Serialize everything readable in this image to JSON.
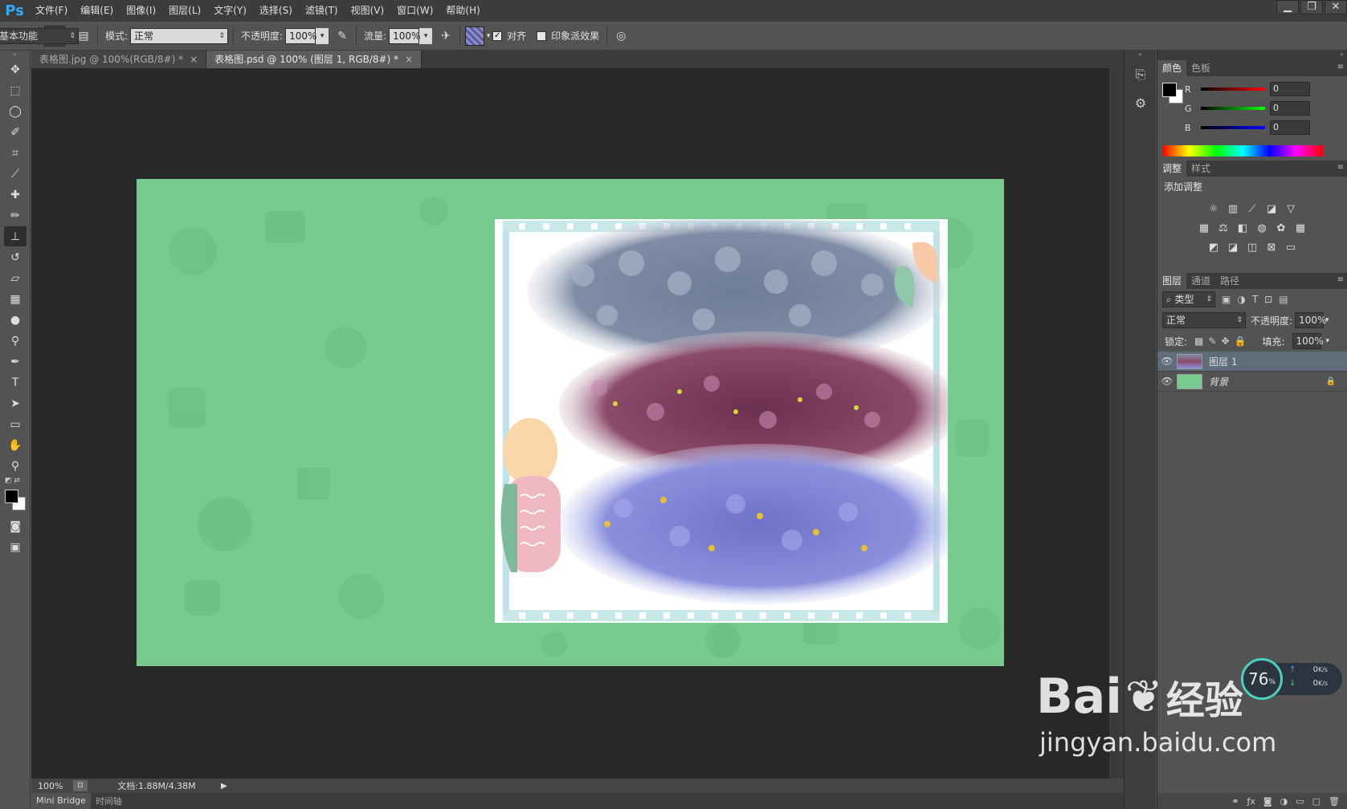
{
  "app": {
    "logo": "Ps"
  },
  "menu": {
    "items": [
      "文件(F)",
      "编辑(E)",
      "图像(I)",
      "图层(L)",
      "文字(Y)",
      "选择(S)",
      "滤镜(T)",
      "视图(V)",
      "窗口(W)",
      "帮助(H)"
    ]
  },
  "window_controls": {
    "minimize": "▁",
    "restore": "❐",
    "close": "✕"
  },
  "options": {
    "brush_size": "80",
    "mode_label": "模式:",
    "mode_value": "正常",
    "opacity_label": "不透明度:",
    "opacity_value": "100%",
    "flow_label": "流量:",
    "flow_value": "100%",
    "align_label": "对齐",
    "impression_label": "印象派效果",
    "workspace": "基本功能"
  },
  "tabs": [
    {
      "label": "表格图.jpg @ 100%(RGB/8#) *"
    },
    {
      "label": "表格图.psd @ 100% (图层 1, RGB/8#) *"
    }
  ],
  "status": {
    "zoom": "100%",
    "doc_info": "文档:1.88M/4.38M"
  },
  "bottom_tabs": [
    "Mini Bridge",
    "时间轴"
  ],
  "color_panel": {
    "tabs": [
      "颜色",
      "色板"
    ],
    "r_label": "R",
    "g_label": "G",
    "b_label": "B",
    "r": "0",
    "g": "0",
    "b": "0"
  },
  "adjust_panel": {
    "tabs": [
      "调整",
      "样式"
    ],
    "title": "添加调整"
  },
  "layers_panel": {
    "tabs": [
      "图层",
      "通道",
      "路径"
    ],
    "filter_label": "类型",
    "blend_mode": "正常",
    "opacity_label": "不透明度:",
    "opacity_value": "100%",
    "lock_label": "锁定:",
    "fill_label": "填充:",
    "fill_value": "100%",
    "layers": [
      {
        "name": "图层 1",
        "selected": true
      },
      {
        "name": "背景",
        "selected": false
      }
    ]
  },
  "net_widget": {
    "percent": "76",
    "percent_sign": "%",
    "up": "0",
    "down": "0",
    "unit": "K/s"
  },
  "watermark": {
    "brand": "Bai",
    "brand2": "经验",
    "url": "jingyan.baidu.com"
  },
  "colors": {
    "canvas_bg": "#79ca8f",
    "workspace": "#282828",
    "panel": "#535353"
  }
}
